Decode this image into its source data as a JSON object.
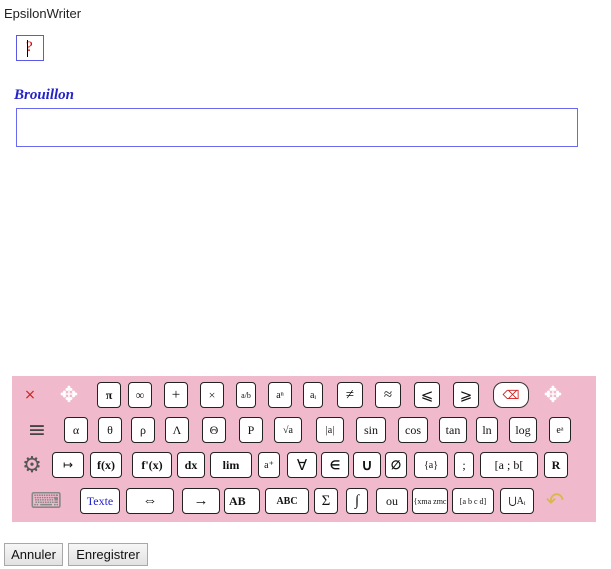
{
  "app": {
    "title": "EpsilonWriter"
  },
  "answer": {
    "placeholder_glyph": "?"
  },
  "draft": {
    "label": "Brouillon",
    "value": ""
  },
  "keyboard": {
    "row1": {
      "close": "×",
      "move": "✥",
      "pi": "π",
      "infinity": "∞",
      "plus": "+",
      "times": "×",
      "fraction": "a/b",
      "power": "aⁿ",
      "index": "aᵢ",
      "not_equal": "≠",
      "approx": "≈",
      "less_equal": "⩽",
      "greater_equal": "⩾",
      "backspace": "⌫",
      "move_right": "✥"
    },
    "row2": {
      "menu": "≡",
      "alpha": "α",
      "theta": "θ",
      "rho": "ρ",
      "capital_lambda": "Λ",
      "capital_theta": "Θ",
      "capital_p": "P",
      "sqrt": "√a",
      "abs": "|a|",
      "sin": "sin",
      "cos": "cos",
      "tan": "tan",
      "ln": "ln",
      "log": "log",
      "exp": "eᵃ"
    },
    "row3": {
      "settings": "⚙",
      "mapsto": "↦",
      "function": "f(x)",
      "derivative": "f'(x)",
      "dx": "dx",
      "lim": "lim",
      "conjugate": "a⁺",
      "forall": "∀",
      "element_of": "∈",
      "union": "∪",
      "empty_set": "∅",
      "set": "{a}",
      "semicolon": ";",
      "interval": "[a ; b[",
      "reals": "R"
    },
    "row4": {
      "keyboard": "⌨",
      "text": "Texte",
      "equivalent": "⇔",
      "implies": "→",
      "vector": "AB⃗",
      "angle": "ABC",
      "sum": "Σ",
      "integral": "∫",
      "or": "ou",
      "system": "{xma zmc",
      "matrix": "[a b c d]",
      "big_union": "⋃Aᵢ",
      "undo": "↶"
    }
  },
  "actions": {
    "cancel": "Annuler",
    "save": "Enregistrer"
  }
}
